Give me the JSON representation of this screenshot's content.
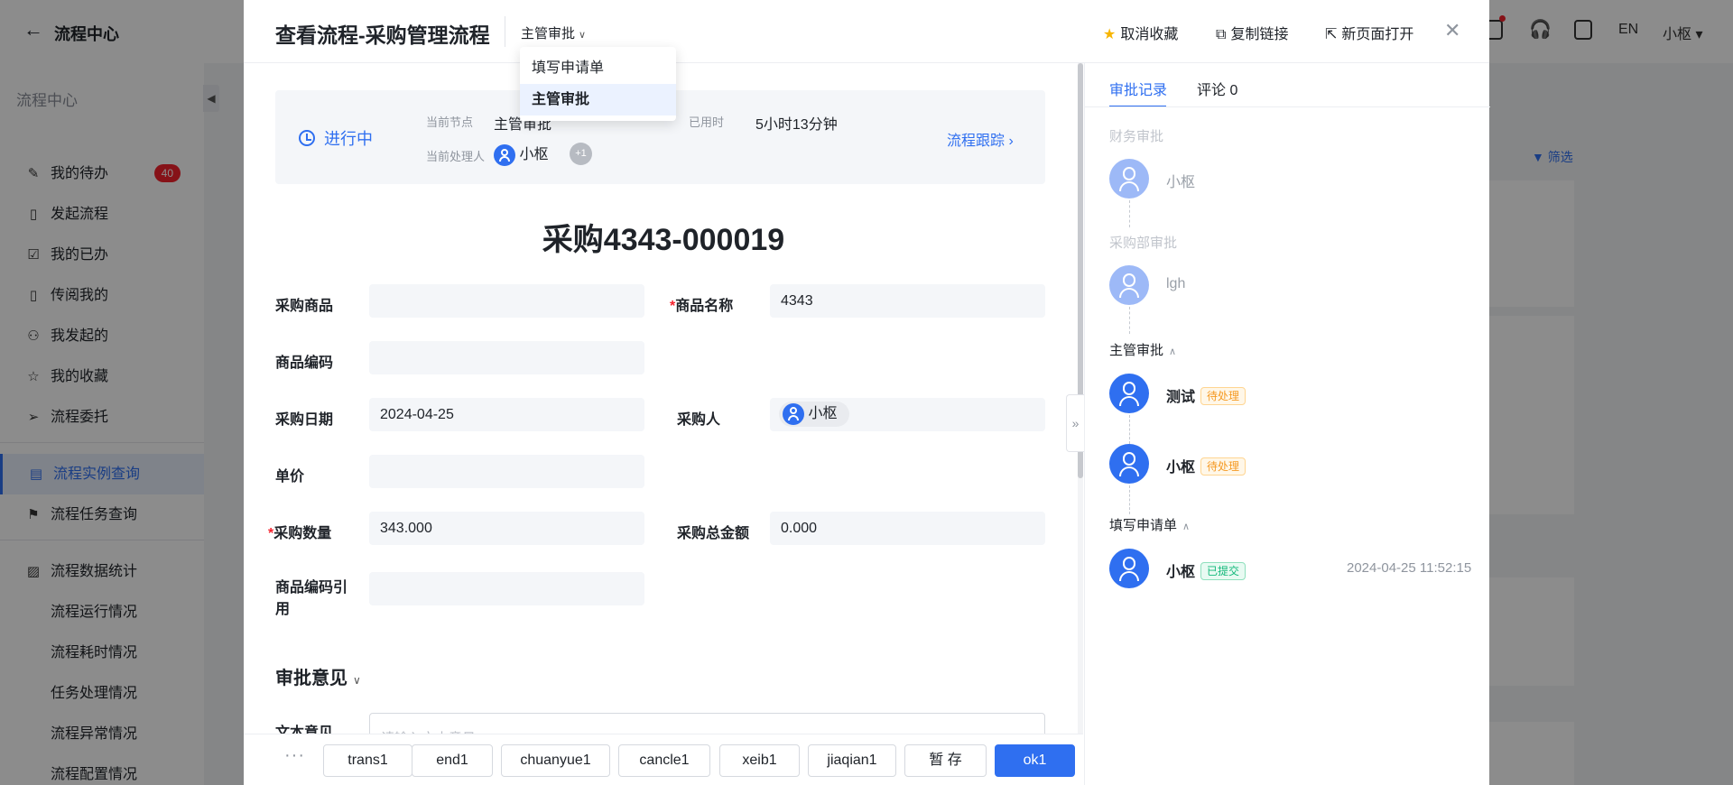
{
  "background": {
    "app_title": "流程中心",
    "language": "EN",
    "user": "小枢",
    "sidebar": {
      "header": "流程中心",
      "items": [
        {
          "label": "我的待办",
          "badge": "40"
        },
        {
          "label": "发起流程"
        },
        {
          "label": "我的已办"
        },
        {
          "label": "传阅我的"
        },
        {
          "label": "我发起的"
        },
        {
          "label": "我的收藏"
        },
        {
          "label": "流程委托"
        },
        {
          "label": "流程实例查询"
        },
        {
          "label": "流程任务查询"
        },
        {
          "label": "流程数据统计"
        }
      ],
      "sub_items": [
        "流程运行情况",
        "流程耗时情况",
        "任务处理情况",
        "流程异常情况",
        "流程配置情况"
      ]
    },
    "filter_label": "筛选"
  },
  "drawer": {
    "title": "查看流程-采购管理流程",
    "node_select": {
      "value": "主管审批",
      "options": [
        "填写申请单",
        "主管审批"
      ]
    },
    "actions": {
      "unfavorite": "取消收藏",
      "copy_link": "复制链接",
      "open_new": "新页面打开"
    }
  },
  "status": {
    "state": "进行中",
    "current_node_label": "当前节点",
    "current_node_value": "主管审批",
    "elapsed_label": "已用时",
    "elapsed_value": "5小时13分钟",
    "handler_label": "当前处理人",
    "handler_name": "小枢",
    "extra_count": "+1",
    "track_link": "流程跟踪"
  },
  "form": {
    "title": "采购4343-000019",
    "fields": {
      "product": {
        "label": "采购商品",
        "value": ""
      },
      "product_name": {
        "label": "商品名称",
        "value": "4343",
        "required": true
      },
      "product_code": {
        "label": "商品编码",
        "value": ""
      },
      "purchase_date": {
        "label": "采购日期",
        "value": "2024-04-25"
      },
      "purchaser": {
        "label": "采购人",
        "value": "小枢"
      },
      "unit_price": {
        "label": "单价",
        "value": ""
      },
      "quantity": {
        "label": "采购数量",
        "value": "343.000",
        "required": true
      },
      "total": {
        "label": "采购总金额",
        "value": "0.000"
      },
      "code_ref": {
        "label": "商品编码引用",
        "value": ""
      }
    },
    "opinion_section": "审批意见",
    "text_opinion_label": "文本意见",
    "text_opinion_placeholder": "请输入文本意见"
  },
  "right_panel": {
    "tabs": [
      "审批记录",
      "评论 0"
    ],
    "records": [
      {
        "group": "财务审批",
        "name": "小枢",
        "faded": true
      },
      {
        "group": "采购部审批",
        "name": "lgh",
        "faded": true
      },
      {
        "group": "主管审批",
        "entries": [
          {
            "name": "测试",
            "tag": "待处理"
          },
          {
            "name": "小枢",
            "tag": "待处理"
          }
        ]
      },
      {
        "group": "填写申请单",
        "entries": [
          {
            "name": "小枢",
            "tag": "已提交",
            "time": "2024-04-25 11:52:15"
          }
        ]
      }
    ]
  },
  "footer": {
    "more": "···",
    "buttons": [
      "trans1",
      "end1",
      "chuanyue1",
      "cancle1",
      "xeib1",
      "jiaqian1",
      "暂 存",
      "ok1"
    ]
  },
  "colors": {
    "primary": "#2f6ff0",
    "pending": "#f59a23",
    "submitted": "#13b87a",
    "required": "#f5222d",
    "star": "#f7b500"
  }
}
